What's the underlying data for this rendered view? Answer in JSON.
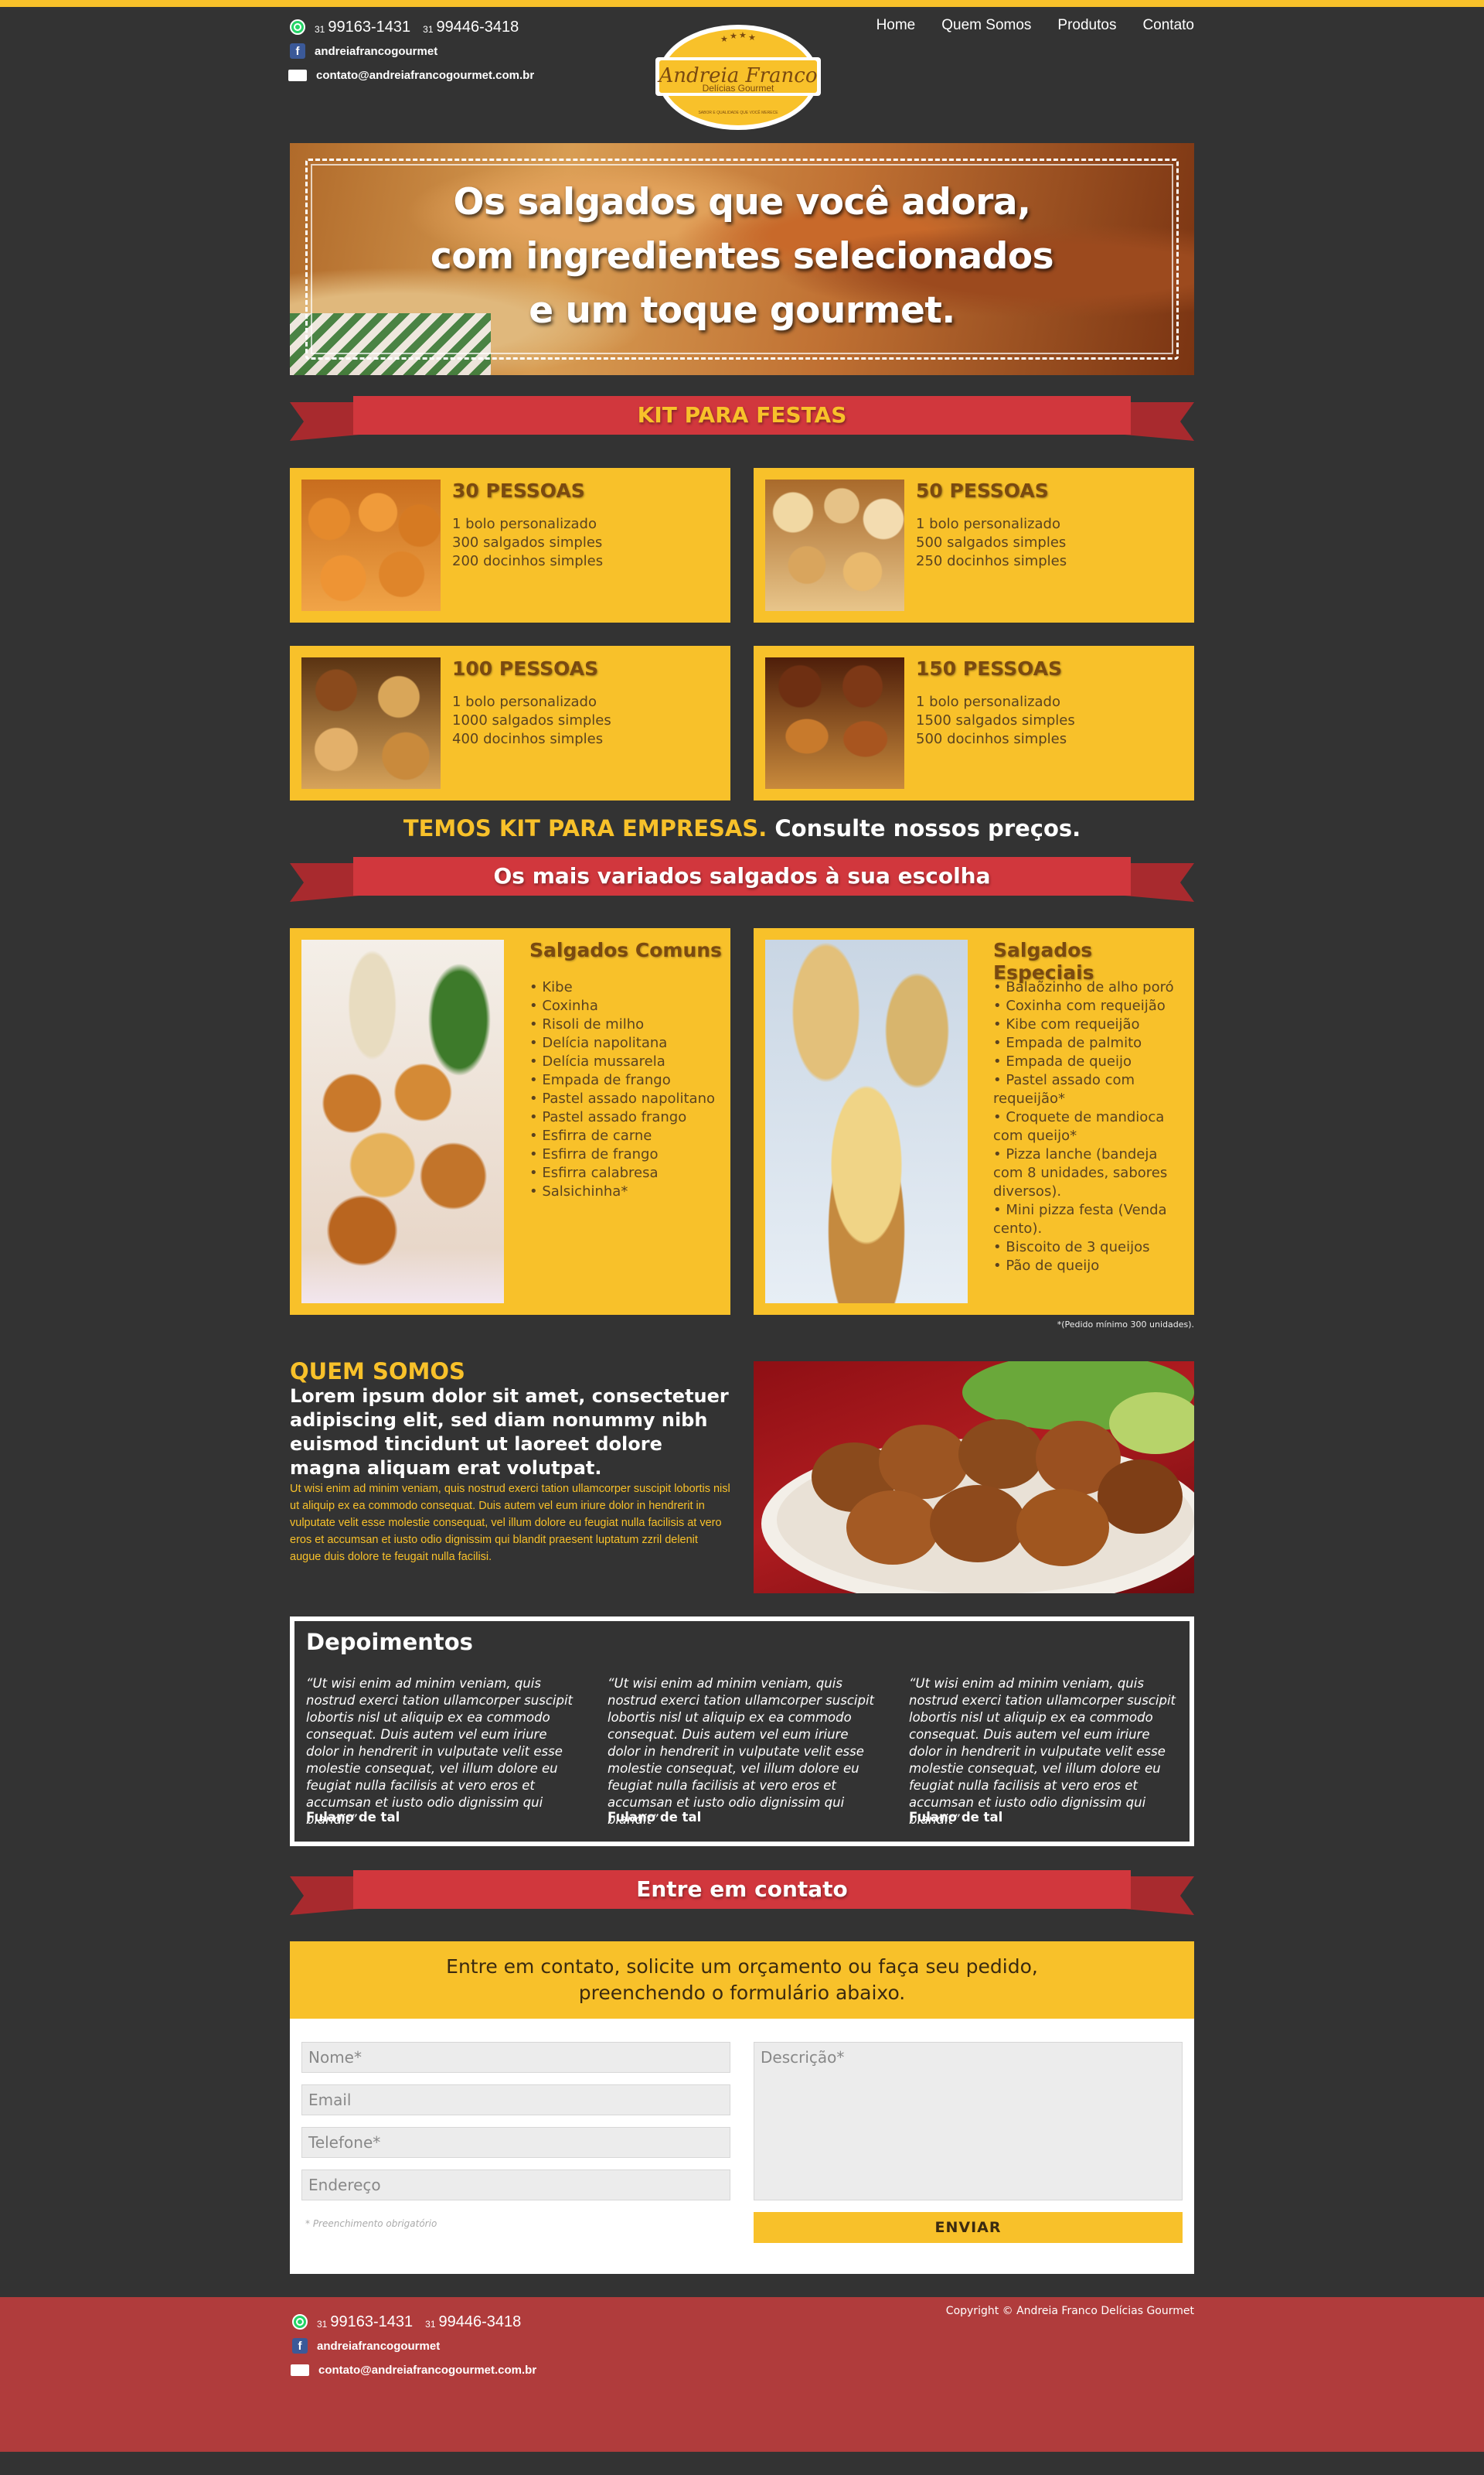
{
  "header": {
    "ddd1": "31",
    "phone1": "99163-1431",
    "ddd2": "31",
    "phone2": "99446-3418",
    "facebook": "andreiafrancogourmet",
    "email": "contato@andreiafrancogourmet.com.br"
  },
  "logo": {
    "name": "Andreia Franco",
    "subtitle": "Delícias Gourmet",
    "tagline": "SABOR E QUALIDADE QUE VOCÊ MERECE"
  },
  "nav": [
    "Home",
    "Quem Somos",
    "Produtos",
    "Contato"
  ],
  "hero": {
    "line1": "Os salgados que você adora,",
    "line2": "com ingredientes selecionados",
    "line3": "e um toque gourmet."
  },
  "kit_ribbon": "KIT PARA FESTAS",
  "kits": [
    {
      "title": "30 PESSOAS",
      "lines": [
        "1 bolo personalizado",
        "300 salgados simples",
        "200 docinhos simples"
      ]
    },
    {
      "title": "50 PESSOAS",
      "lines": [
        "1 bolo personalizado",
        "500 salgados simples",
        "250 docinhos simples"
      ]
    },
    {
      "title": "100 PESSOAS",
      "lines": [
        "1 bolo personalizado",
        "1000 salgados simples",
        "400 docinhos simples"
      ]
    },
    {
      "title": "150 PESSOAS",
      "lines": [
        "1 bolo personalizado",
        "1500 salgados simples",
        "500 docinhos simples"
      ]
    }
  ],
  "empresas": {
    "highlight": "TEMOS KIT PARA EMPRESAS.",
    "rest": "Consulte nossos preços."
  },
  "variados_ribbon": "Os mais variados salgados à sua escolha",
  "comuns": {
    "title": "Salgados Comuns",
    "items": [
      "• Kibe",
      "• Coxinha",
      "• Risoli de milho",
      "• Delícia napolitana",
      "• Delícia mussarela",
      "• Empada de frango",
      "• Pastel assado napolitano",
      "• Pastel assado frango",
      "• Esfirra de carne",
      "• Esfirra de frango",
      "• Esfirra calabresa",
      "• Salsichinha*"
    ]
  },
  "especiais": {
    "title": "Salgados Especiais",
    "items": [
      "• Balaõzinho de alho poró",
      "• Coxinha com requeijão",
      "• Kibe com requeijão",
      "• Empada de palmito",
      "• Empada de queijo",
      "• Pastel assado com requeijão*",
      "• Croquete de mandioca com queijo*",
      "• Pizza lanche (bandeja com 8 unidades, sabores diversos).",
      "• Mini pizza festa (Venda cento).",
      "• Biscoito de 3 queijos",
      "• Pão de queijo"
    ]
  },
  "footnote": "*(Pedido mínimo 300 unidades).",
  "quem": {
    "title": "QUEM SOMOS",
    "lead": "Lorem ipsum dolor sit amet, consectetuer adipiscing elit, sed diam nonummy nibh euismod tincidunt ut laoreet dolore magna aliquam erat volutpat.",
    "body": "Ut wisi enim ad minim veniam, quis nostrud exerci tation ullamcorper suscipit lobortis nisl ut aliquip ex ea commodo consequat. Duis autem vel eum iriure dolor in hendrerit in vulputate velit esse molestie consequat, vel illum dolore eu feugiat nulla facilisis at vero eros et accumsan et iusto odio dignissim qui blandit praesent luptatum zzril delenit augue duis dolore te feugait nulla facilisi."
  },
  "depoimentos": {
    "title": "Depoimentos",
    "items": [
      {
        "quote": "“Ut wisi enim ad minim veniam, quis nostrud exerci tation ullamcorper suscipit lobortis nisl ut aliquip ex ea commodo consequat. Duis autem vel eum iriure dolor in hendrerit in vulputate velit esse molestie consequat, vel illum dolore eu feugiat nulla facilisis at vero eros et accumsan et iusto odio dignissim qui blandit”",
        "name": "Fulano de tal"
      },
      {
        "quote": "“Ut wisi enim ad minim veniam, quis nostrud exerci tation ullamcorper suscipit lobortis nisl ut aliquip ex ea commodo consequat. Duis autem vel eum iriure dolor in hendrerit in vulputate velit esse molestie consequat, vel illum dolore eu feugiat nulla facilisis at vero eros et accumsan et iusto odio dignissim qui blandit”",
        "name": "Fulano de tal"
      },
      {
        "quote": "“Ut wisi enim ad minim veniam, quis nostrud exerci tation ullamcorper suscipit lobortis nisl ut aliquip ex ea commodo consequat. Duis autem vel eum iriure dolor in hendrerit in vulputate velit esse molestie consequat, vel illum dolore eu feugiat nulla facilisis at vero eros et accumsan et iusto odio dignissim qui blandit”",
        "name": "Fulano de tal"
      }
    ]
  },
  "contato_ribbon": "Entre em contato",
  "contact": {
    "line1": "Entre em contato, solicite um orçamento ou faça seu pedido,",
    "line2": "preenchendo o formulário abaixo.",
    "nome": "Nome*",
    "email": "Email",
    "telefone": "Telefone*",
    "endereco": "Endereço",
    "descricao": "Descrição*",
    "obrigatorio": "* Preenchimento obrigatório",
    "send": "ENVIAR"
  },
  "footer": {
    "copyright": "Copyright © Andreia Franco Delícias Gourmet"
  },
  "colors": {
    "background": "#333333",
    "accent_yellow": "#f8c12a",
    "ribbon_red": "#d1373d",
    "footer_red": "#b03c3c"
  }
}
